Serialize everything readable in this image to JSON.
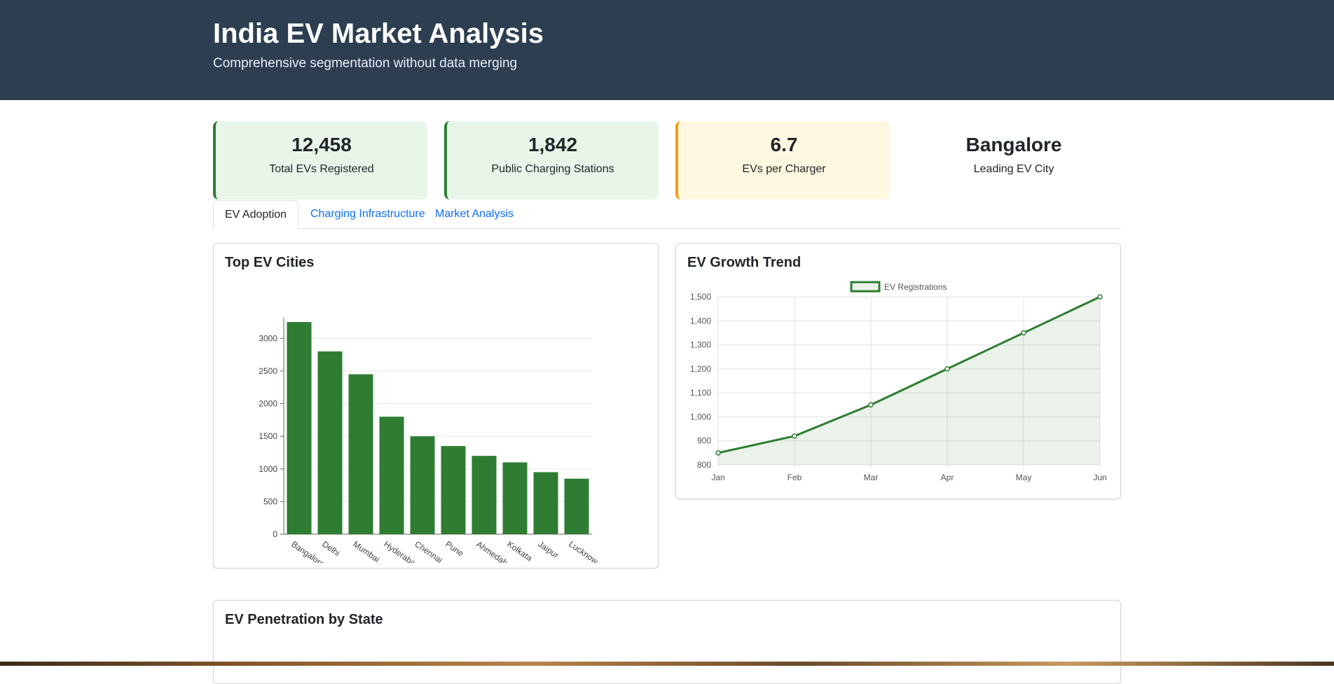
{
  "header": {
    "title": "India EV Market Analysis",
    "subtitle": "Comprehensive segmentation without data merging"
  },
  "stats": [
    {
      "value": "12,458",
      "label": "Total EVs Registered"
    },
    {
      "value": "1,842",
      "label": "Public Charging Stations"
    },
    {
      "value": "6.7",
      "label": "EVs per Charger"
    },
    {
      "value": "Bangalore",
      "label": "Leading EV City"
    }
  ],
  "tabs": [
    {
      "label": "EV Adoption"
    },
    {
      "label": "Charging Infrastructure"
    },
    {
      "label": "Market Analysis"
    }
  ],
  "cards": {
    "top_cities_title": "Top EV Cities",
    "growth_title": "EV Growth Trend",
    "penetration_title": "EV Penetration by State"
  },
  "colors": {
    "header_bg": "#2c3e50",
    "accent_green": "#2e7d32",
    "accent_orange": "#f39c12"
  },
  "chart_data": [
    {
      "type": "bar",
      "title": "Top EV Cities",
      "categories": [
        "Bangalore",
        "Delhi",
        "Mumbai",
        "Hyderabad",
        "Chennai",
        "Pune",
        "Ahmedabad",
        "Kolkata",
        "Jaipur",
        "Lucknow"
      ],
      "values": [
        3250,
        2800,
        2450,
        1800,
        1500,
        1350,
        1200,
        1100,
        950,
        850
      ],
      "yticks": [
        0,
        500,
        1000,
        1500,
        2000,
        2500,
        3000
      ],
      "ylim": [
        0,
        3250
      ],
      "grid": true,
      "color": "#2e7d32"
    },
    {
      "type": "area",
      "title": "EV Growth Trend",
      "categories": [
        "Jan",
        "Feb",
        "Mar",
        "Apr",
        "May",
        "Jun"
      ],
      "series": [
        {
          "name": "EV Registrations",
          "values": [
            850,
            920,
            1050,
            1200,
            1350,
            1500
          ]
        }
      ],
      "yticks": [
        "800",
        "900",
        "1,000",
        "1,100",
        "1,200",
        "1,300",
        "1,400",
        "1,500"
      ],
      "ylim": [
        800,
        1500
      ],
      "grid": true,
      "legend": "top",
      "color": "#2e7d32"
    }
  ]
}
